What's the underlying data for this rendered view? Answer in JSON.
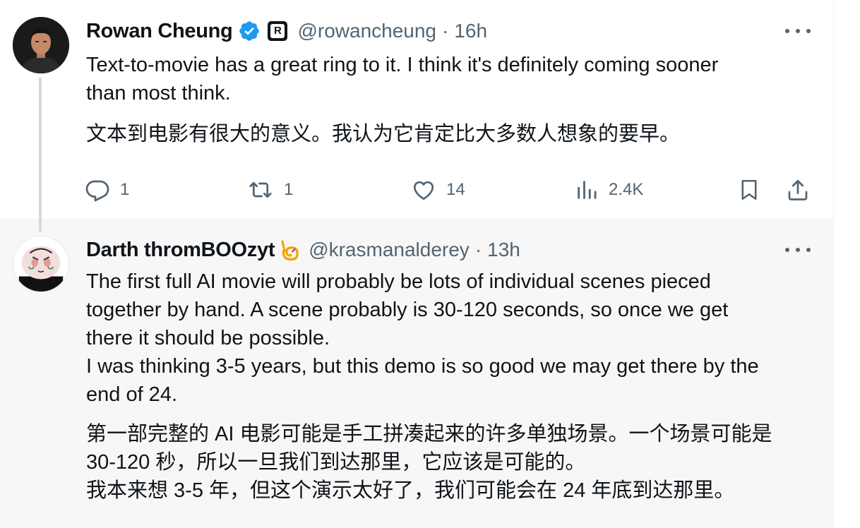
{
  "tweet1": {
    "author_name": "Rowan Cheung",
    "handle": "@rowancheung",
    "separator": "·",
    "time": "16h",
    "text_lines": [
      "Text-to-movie has a great ring to it. I think it's definitely coming sooner",
      "than most think."
    ],
    "translation": "文本到电影有很大的意义。我认为它肯定比大多数人想象的要早。",
    "actions": {
      "replies": "1",
      "reposts": "1",
      "likes": "14",
      "views": "2.4K"
    },
    "icons": [
      "verified-badge-icon",
      "affiliation-badge-icon",
      "more-icon",
      "reply-icon",
      "repost-icon",
      "like-icon",
      "views-icon",
      "bookmark-icon",
      "share-icon"
    ]
  },
  "tweet2": {
    "author_name": "Darth thromBOOzyt",
    "handle": "@krasmanalderey",
    "separator": "·",
    "time": "13h",
    "text_lines": [
      "The first full AI movie will probably be lots of individual scenes pieced",
      "together by hand. A scene probably is 30-120 seconds, so once we get",
      "there it should be possible.",
      "I was thinking 3-5 years, but this demo is so good we may get there by the",
      "end of 24."
    ],
    "translation_lines": [
      "第一部完整的 AI 电影可能是手工拼凑起来的许多单独场景。一个场景可能是",
      "30-120 秒，所以一旦我们到达那里，它应该是可能的。",
      "我本来想 3-5 年，但这个演示太好了，我们可能会在 24 年底到达那里。"
    ],
    "icons": [
      "emoji-badge-icon",
      "more-icon"
    ]
  },
  "colors": {
    "text": "#0f1419",
    "secondary": "#536471",
    "verified": "#1d9bf0",
    "thread_line": "#cfd9de",
    "highlight_bg": "#f7f7f7",
    "emoji_badge": "#f4a300"
  }
}
